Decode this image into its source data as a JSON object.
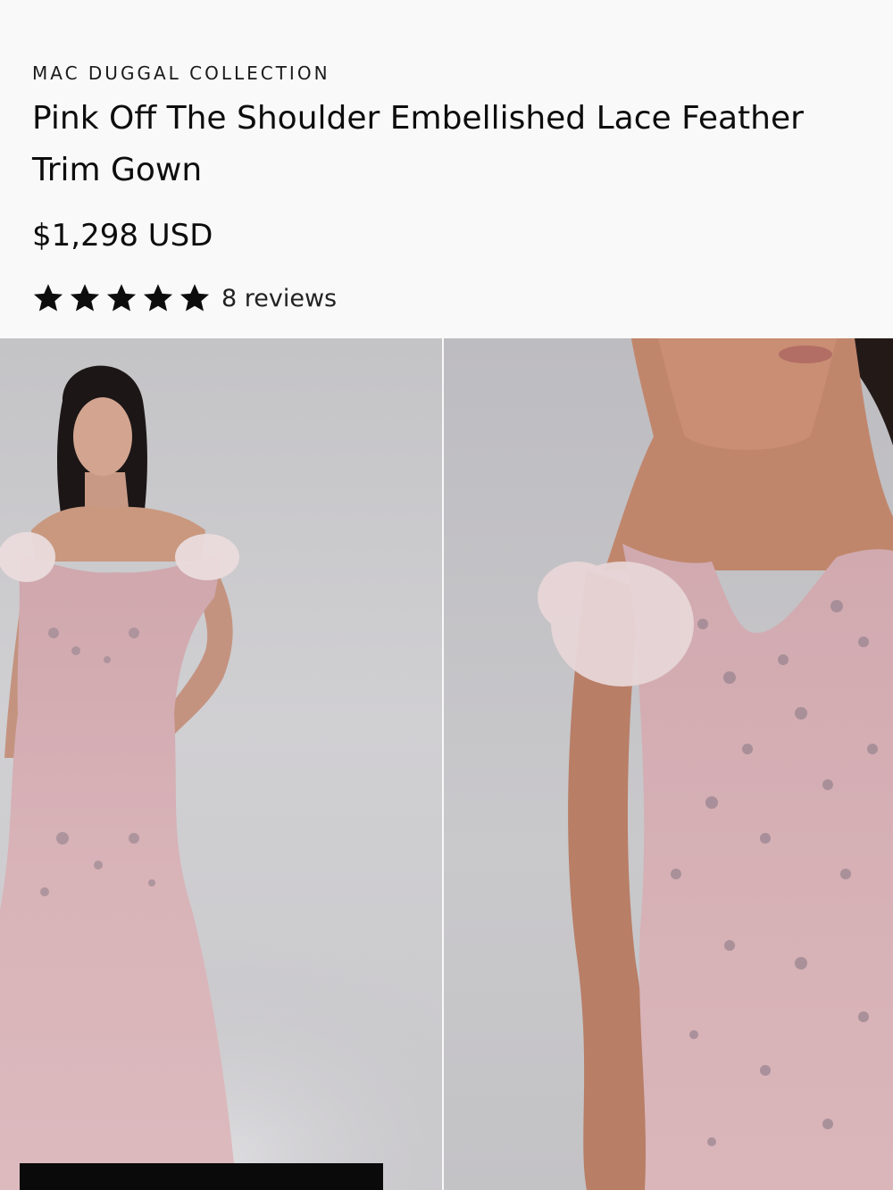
{
  "product": {
    "brand": "MAC DUGGAL COLLECTION",
    "title": "Pink Off The Shoulder Embellished Lace Feather Trim Gown",
    "price": "$1,298 USD",
    "rating": 5,
    "reviews_label": "8 reviews"
  },
  "gallery": {
    "images": [
      {
        "alt": "Model wearing pink off the shoulder embellished lace feather trim gown, full length"
      },
      {
        "alt": "Close-up of pink off the shoulder embellished lace bodice with feather trim"
      }
    ],
    "zoom_icon": "zoom-in-icon"
  },
  "colors": {
    "text": "#0d0d0d",
    "background": "#f9f9f9",
    "gown_pink": "#d9b5b9",
    "feather": "#e6d0d2"
  }
}
